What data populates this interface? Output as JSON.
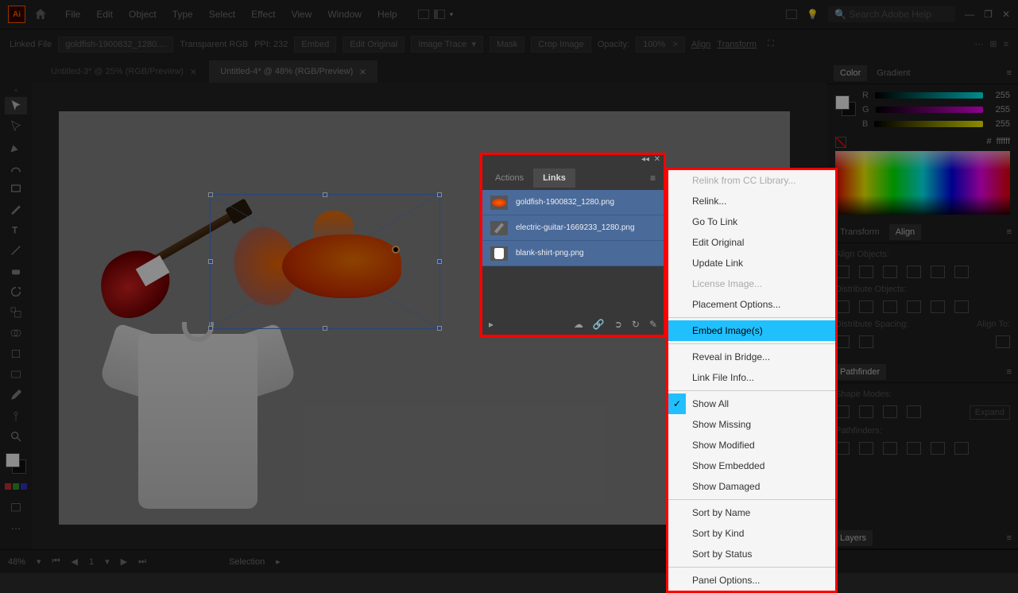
{
  "menubar": {
    "items": [
      "File",
      "Edit",
      "Object",
      "Type",
      "Select",
      "Effect",
      "View",
      "Window",
      "Help"
    ],
    "search_placeholder": "Search Adobe Help"
  },
  "controlbar": {
    "linked_file": "Linked File",
    "filename": "goldfish-1900832_1280....",
    "colormode": "Transparent RGB",
    "ppi": "PPI: 232",
    "embed": "Embed",
    "edit_orig": "Edit Original",
    "img_trace": "Image Trace",
    "mask": "Mask",
    "crop": "Crop Image",
    "opacity_label": "Opacity:",
    "opacity_val": "100%",
    "align": "Align",
    "transform": "Transform"
  },
  "tabs": [
    {
      "label": "Untitled-3* @ 25% (RGB/Preview)",
      "active": false
    },
    {
      "label": "Untitled-4* @ 48% (RGB/Preview)",
      "active": true
    }
  ],
  "links_panel": {
    "tabs": [
      "Actions",
      "Links"
    ],
    "items": [
      {
        "name": "goldfish-1900832_1280.png"
      },
      {
        "name": "electric-guitar-1669233_1280.png"
      },
      {
        "name": "blank-shirt-png.png"
      }
    ]
  },
  "context_menu": [
    {
      "label": "Relink from CC Library...",
      "disabled": true
    },
    {
      "label": "Relink..."
    },
    {
      "label": "Go To Link"
    },
    {
      "label": "Edit Original"
    },
    {
      "label": "Update Link"
    },
    {
      "label": "License Image...",
      "disabled": true
    },
    {
      "label": "Placement Options..."
    },
    {
      "sep": true
    },
    {
      "label": "Embed Image(s)",
      "highlight": true
    },
    {
      "sep": true
    },
    {
      "label": "Reveal in Bridge..."
    },
    {
      "label": "Link File Info..."
    },
    {
      "sep": true
    },
    {
      "label": "Show All",
      "checked": true
    },
    {
      "label": "Show Missing"
    },
    {
      "label": "Show Modified"
    },
    {
      "label": "Show Embedded"
    },
    {
      "label": "Show Damaged"
    },
    {
      "sep": true
    },
    {
      "label": "Sort by Name"
    },
    {
      "label": "Sort by Kind"
    },
    {
      "label": "Sort by Status"
    },
    {
      "sep": true
    },
    {
      "label": "Panel Options..."
    }
  ],
  "color_panel": {
    "tab1": "Color",
    "tab2": "Gradient",
    "r": "255",
    "g": "255",
    "b": "255",
    "hex_prefix": "#",
    "hex": "ffffff"
  },
  "align_panel": {
    "tab_transform": "Transform",
    "tab_align": "Align",
    "sec1": "Align Objects:",
    "sec2": "Distribute Objects:",
    "sec3": "Distribute Spacing:",
    "align_to": "Align To:"
  },
  "pathfinder": {
    "tab": "Pathfinder",
    "shape_modes": "Shape Modes:",
    "pathfinders": "Pathfinders:",
    "expand": "Expand"
  },
  "layers_tab": "Layers",
  "statusbar": {
    "zoom": "48%",
    "selection": "Selection"
  }
}
